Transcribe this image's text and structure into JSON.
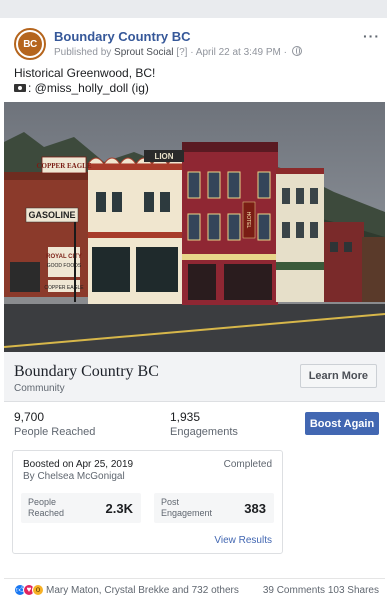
{
  "post": {
    "avatar_initials": "BC",
    "page_name": "Boundary Country BC",
    "meta_prefix": "Published by",
    "publisher": "Sprout Social",
    "info_marker": "[?]",
    "timestamp": "April 22 at 3:49 PM",
    "text_line1": "Historical Greenwood, BC!",
    "text_line2": ": @miss_holly_doll (ig)",
    "more_label": "···"
  },
  "photo": {
    "signs": {
      "copper_eagle": "COPPER EAGLE",
      "gasoline": "GASOLINE",
      "royal_city": "ROYAL CITY",
      "good_foods": "GOOD FOODS",
      "copper_eagle_small": "COPPER EAGLE",
      "lion": "LION",
      "hotel": "HOTEL"
    }
  },
  "link": {
    "title": "Boundary Country BC",
    "category": "Community",
    "learn_more": "Learn More"
  },
  "stats": {
    "reached_value": "9,700",
    "reached_label": "People Reached",
    "engagements_value": "1,935",
    "engagements_label": "Engagements",
    "boost_again": "Boost Again"
  },
  "boost": {
    "date": "Boosted on Apr 25, 2019",
    "by": "By Chelsea McGonigal",
    "status": "Completed",
    "people_reached_label": "People Reached",
    "people_reached_value": "2.3K",
    "post_engagement_label": "Post Engagement",
    "post_engagement_value": "383",
    "view_results": "View Results"
  },
  "reactions": {
    "names": "Mary Maton, Crystal Brekke and 732 others",
    "comments": "39 Comments",
    "shares": "103 Shares"
  },
  "colors": {
    "brand_blue": "#4267b2",
    "link_blue": "#365899",
    "avatar_brown": "#b5651d"
  }
}
